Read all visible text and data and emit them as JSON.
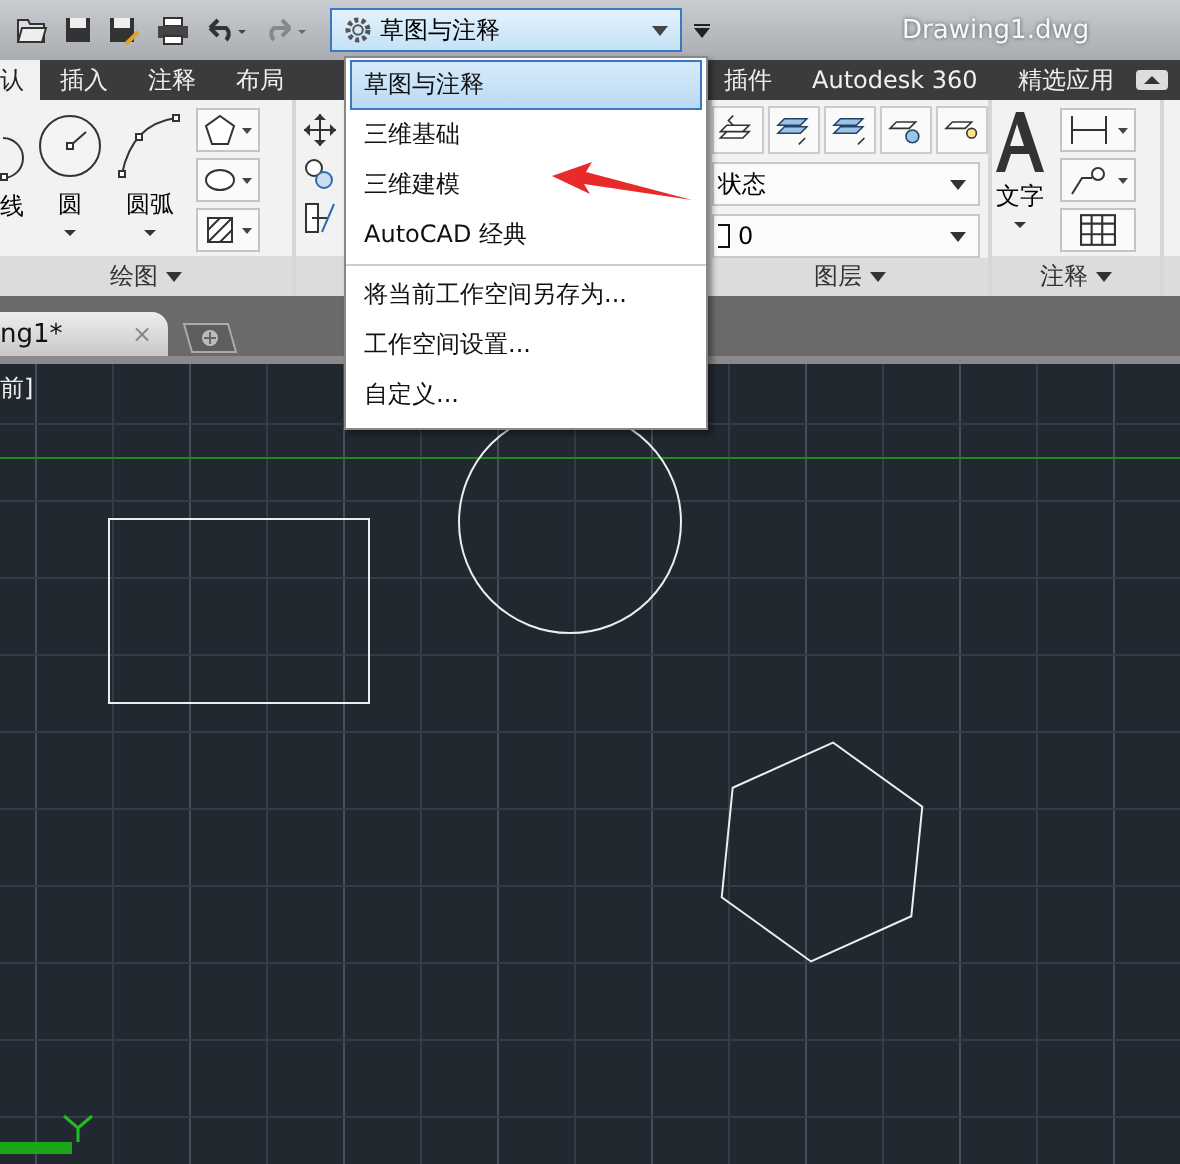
{
  "title": "Drawing1.dwg",
  "workspace_combo": "草图与注释",
  "tabs_left": [
    {
      "label": "认",
      "selected": true
    },
    {
      "label": "插入",
      "selected": false
    },
    {
      "label": "注释",
      "selected": false
    },
    {
      "label": "布局",
      "selected": false
    }
  ],
  "tabs_right": [
    {
      "label": "插件",
      "selected": false
    },
    {
      "label": "Autodesk 360",
      "selected": false
    },
    {
      "label": "精选应用",
      "selected": false
    }
  ],
  "draw_panel": {
    "tools": [
      "线",
      "圆",
      "圆弧"
    ],
    "title": "绘图"
  },
  "layers_panel": {
    "state_combo": "状态",
    "layer_combo": "0",
    "title": "图层"
  },
  "annotation_panel": {
    "text_tool": "文字",
    "title": "注释"
  },
  "doc_tab": {
    "label": "ng1*",
    "close": "×"
  },
  "viewport_label": "前]",
  "workspace_menu": {
    "items": [
      {
        "label": "草图与注释",
        "selected": true
      },
      {
        "label": "三维基础",
        "selected": false
      },
      {
        "label": "三维建模",
        "selected": false
      },
      {
        "label": "AutoCAD 经典",
        "selected": false
      }
    ],
    "actions": [
      "将当前工作空间另存为...",
      "工作空间设置...",
      "自定义..."
    ]
  }
}
